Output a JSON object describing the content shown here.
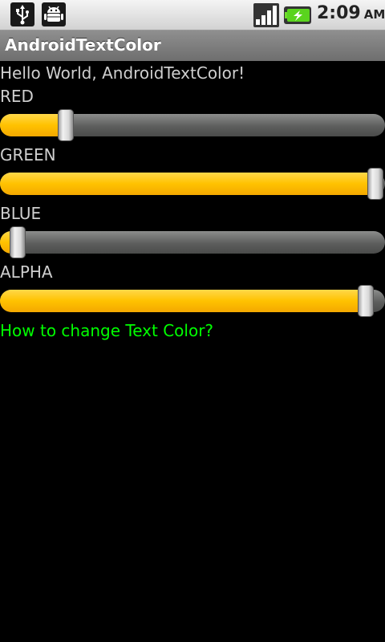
{
  "status_bar": {
    "time": "2:09",
    "ampm": "AM",
    "icons": [
      "usb-icon",
      "android-debug-icon",
      "signal-icon",
      "battery-charging-icon"
    ]
  },
  "app": {
    "title": "AndroidTextColor"
  },
  "content": {
    "hello": "Hello World, AndroidTextColor!",
    "link_text": "How to change Text Color?",
    "link_color": "#00ff00",
    "sliders": [
      {
        "label": "RED",
        "progress": 0.17
      },
      {
        "label": "GREEN",
        "progress": 0.975
      },
      {
        "label": "BLUE",
        "progress": 0.045
      },
      {
        "label": "ALPHA",
        "progress": 0.95
      }
    ]
  },
  "colors": {
    "progress_fill": "#ffc200",
    "track": "#5d5e5d",
    "background": "#000000"
  }
}
